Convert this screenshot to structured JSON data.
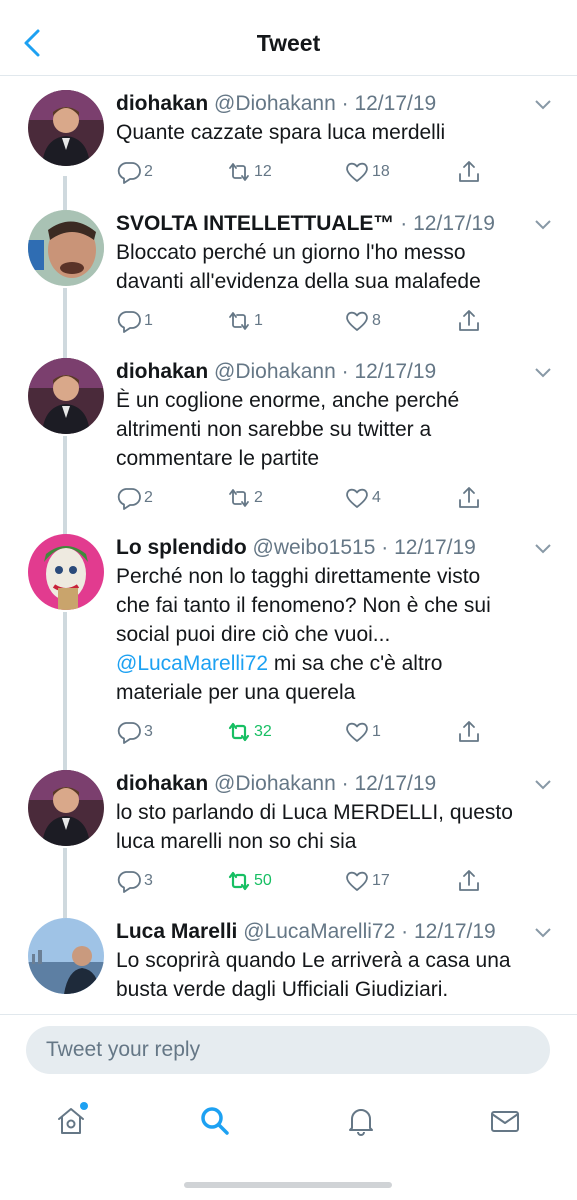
{
  "header": {
    "title": "Tweet"
  },
  "colors": {
    "accent": "#1da1f2",
    "retweet_active": "#17bf63",
    "muted": "#657786"
  },
  "tweets": [
    {
      "name": "diohakan",
      "handle": "@Diohakann",
      "sep": "·",
      "date": "12/17/19",
      "lines": [
        "Quante cazzate spara luca merdelli"
      ],
      "replies": "2",
      "retweets": "12",
      "likes": "18",
      "rt_active": false
    },
    {
      "name": "SVOLTA INTELLETTUALE™",
      "handle": "",
      "sep": "·",
      "date": "12/17/19",
      "lines": [
        "Bloccato perché un giorno l'ho messo",
        "davanti all'evidenza della sua malafede"
      ],
      "replies": "1",
      "retweets": "1",
      "likes": "8",
      "rt_active": false
    },
    {
      "name": "diohakan",
      "handle": "@Diohakann",
      "sep": "·",
      "date": "12/17/19",
      "lines": [
        "È un coglione enorme, anche perché",
        "altrimenti non sarebbe su twitter a",
        "commentare le partite"
      ],
      "replies": "2",
      "retweets": "2",
      "likes": "4",
      "rt_active": false
    },
    {
      "name": "Lo splendido",
      "handle": "@weibo1515",
      "sep": "·",
      "date": "12/17/19",
      "lines": [
        "Perché non lo tagghi direttamente visto",
        "che fai tanto il fenomeno? Non è che sui",
        "social puoi dire ciò che vuoi..."
      ],
      "mention": "@LucaMarelli72",
      "mention_rest": " mi sa che c'è altro",
      "last_line": "materiale per una querela",
      "replies": "3",
      "retweets": "32",
      "likes": "1",
      "rt_active": true
    },
    {
      "name": "diohakan",
      "handle": "@Diohakann",
      "sep": "·",
      "date": "12/17/19",
      "lines": [
        "lo sto parlando di Luca MERDELLI, questo",
        "luca marelli non so chi sia"
      ],
      "replies": "3",
      "retweets": "50",
      "likes": "17",
      "rt_active": true
    },
    {
      "name": "Luca Marelli",
      "handle": "@LucaMarelli72",
      "sep": "·",
      "date": "12/17/19",
      "lines": [
        "Lo scoprirà quando Le arriverà a casa una",
        "busta verde dagli Ufficiali Giudiziari."
      ],
      "replies": "",
      "retweets": "",
      "likes": "",
      "rt_active": false
    }
  ],
  "reply": {
    "placeholder": "Tweet your reply"
  },
  "tabs": [
    "home-icon",
    "search-icon",
    "bell-icon",
    "mail-icon"
  ]
}
